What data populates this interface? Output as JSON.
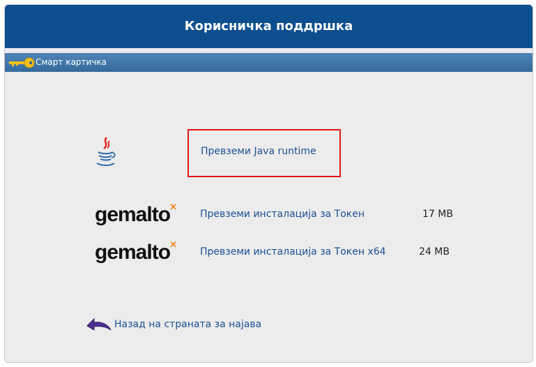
{
  "header": {
    "title": "Корисничка поддршка"
  },
  "subbar": {
    "label": "Смарт картичка",
    "icon": "key-icon"
  },
  "downloads": {
    "java": {
      "label": "Превземи Java runtime",
      "icon": "java-icon"
    },
    "token": [
      {
        "logo": "gemalto",
        "label": "Превземи инсталација за Токен",
        "size": "17 MB"
      },
      {
        "logo": "gemalto",
        "label": "Превземи инсталација за Токен x64",
        "size": "24 MB"
      }
    ]
  },
  "back": {
    "label": "Назад на страната за најава",
    "icon": "back-arrow-icon"
  },
  "colors": {
    "header_bg": "#0d4f8e",
    "subbar_bg": "#356b9c",
    "link": "#1a4f93",
    "highlight": "#e01616"
  }
}
